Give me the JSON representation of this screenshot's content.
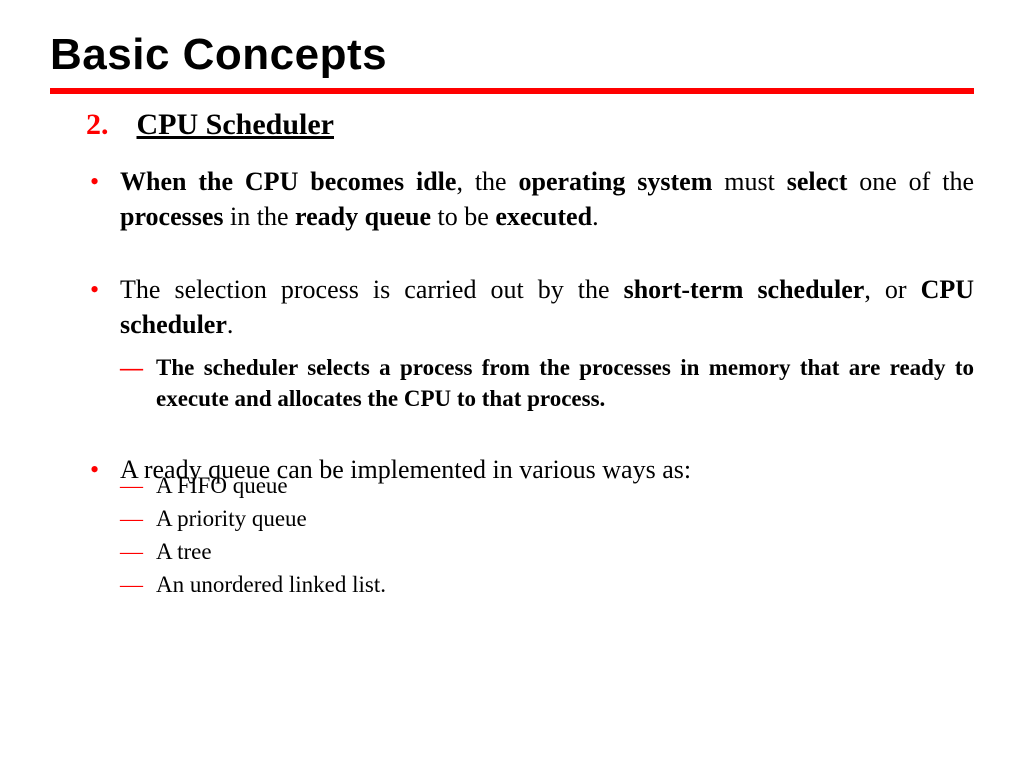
{
  "title": "Basic Concepts",
  "section": {
    "number": "2.",
    "heading": "CPU Scheduler"
  },
  "bullets": {
    "b1": "<b>When the CPU becomes idle</b>, the <b>operating system</b> must <b>select</b> one of the <b>processes</b> in the <b>ready queue</b> to be <b>executed</b>.",
    "b2": "The selection process is carried out by the <b>short-term scheduler</b>, or <b>CPU scheduler</b>.",
    "b2_sub": "The scheduler selects a process from the processes in memory that are ready to execute and allocates the CPU to that process.",
    "b3": "A ready queue can be implemented in various ways as:",
    "b3_sub1": "A FIFO queue",
    "b3_sub2": "A priority queue",
    "b3_sub3": "A tree",
    "b3_sub4": "An unordered linked list."
  }
}
